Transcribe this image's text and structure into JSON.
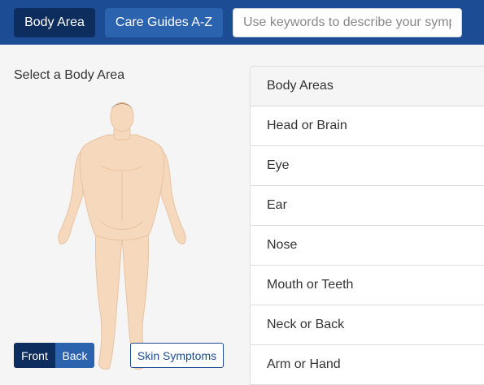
{
  "nav": {
    "body_area_label": "Body Area",
    "care_guides_label": "Care Guides A-Z",
    "search_placeholder": "Use keywords to describe your sympt"
  },
  "select": {
    "label": "Select a Body Area"
  },
  "view_toggle": {
    "front_label": "Front",
    "back_label": "Back"
  },
  "skin_symptoms_label": "Skin Symptoms",
  "panel": {
    "heading": "Body Areas",
    "items": [
      {
        "label": "Head or Brain"
      },
      {
        "label": "Eye"
      },
      {
        "label": "Ear"
      },
      {
        "label": "Nose"
      },
      {
        "label": "Mouth or Teeth"
      },
      {
        "label": "Neck or Back"
      },
      {
        "label": "Arm or Hand"
      }
    ]
  },
  "colors": {
    "navbar": "#1b4c94",
    "active_button": "#0d2d5e",
    "inactive_button": "#2c63ae",
    "skin": "#f6d9bd",
    "hair": "#5b3a24"
  }
}
